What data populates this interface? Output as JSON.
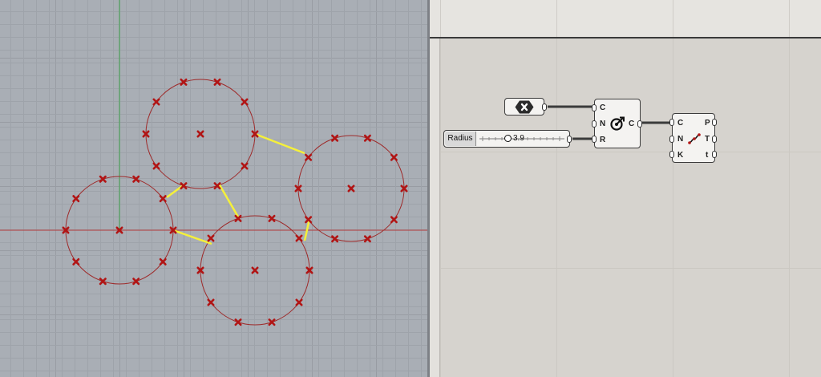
{
  "viewport": {
    "axis_colors": {
      "x_axis": "#b33a3a",
      "y_axis": "#3fa34d"
    },
    "circle_color": "#9e2a2a",
    "point_color": "#b11515",
    "line_color": "#f5f03a",
    "icons": {
      "point_marker": "x-cross-icon"
    }
  },
  "grasshopper": {
    "circle_component": {
      "inputs": [
        "C",
        "N",
        "R"
      ],
      "outputs": [
        "C"
      ],
      "icon": "circle-cnr-icon"
    },
    "curve_closest_component": {
      "inputs": [
        "C",
        "N",
        "K"
      ],
      "outputs": [
        "P",
        "T",
        "t"
      ],
      "icon": "curve-points-icon"
    },
    "geometry_param": {
      "icon": "hexagon-geometry-icon"
    },
    "slider": {
      "name": "Radius",
      "value": "3.9"
    }
  }
}
